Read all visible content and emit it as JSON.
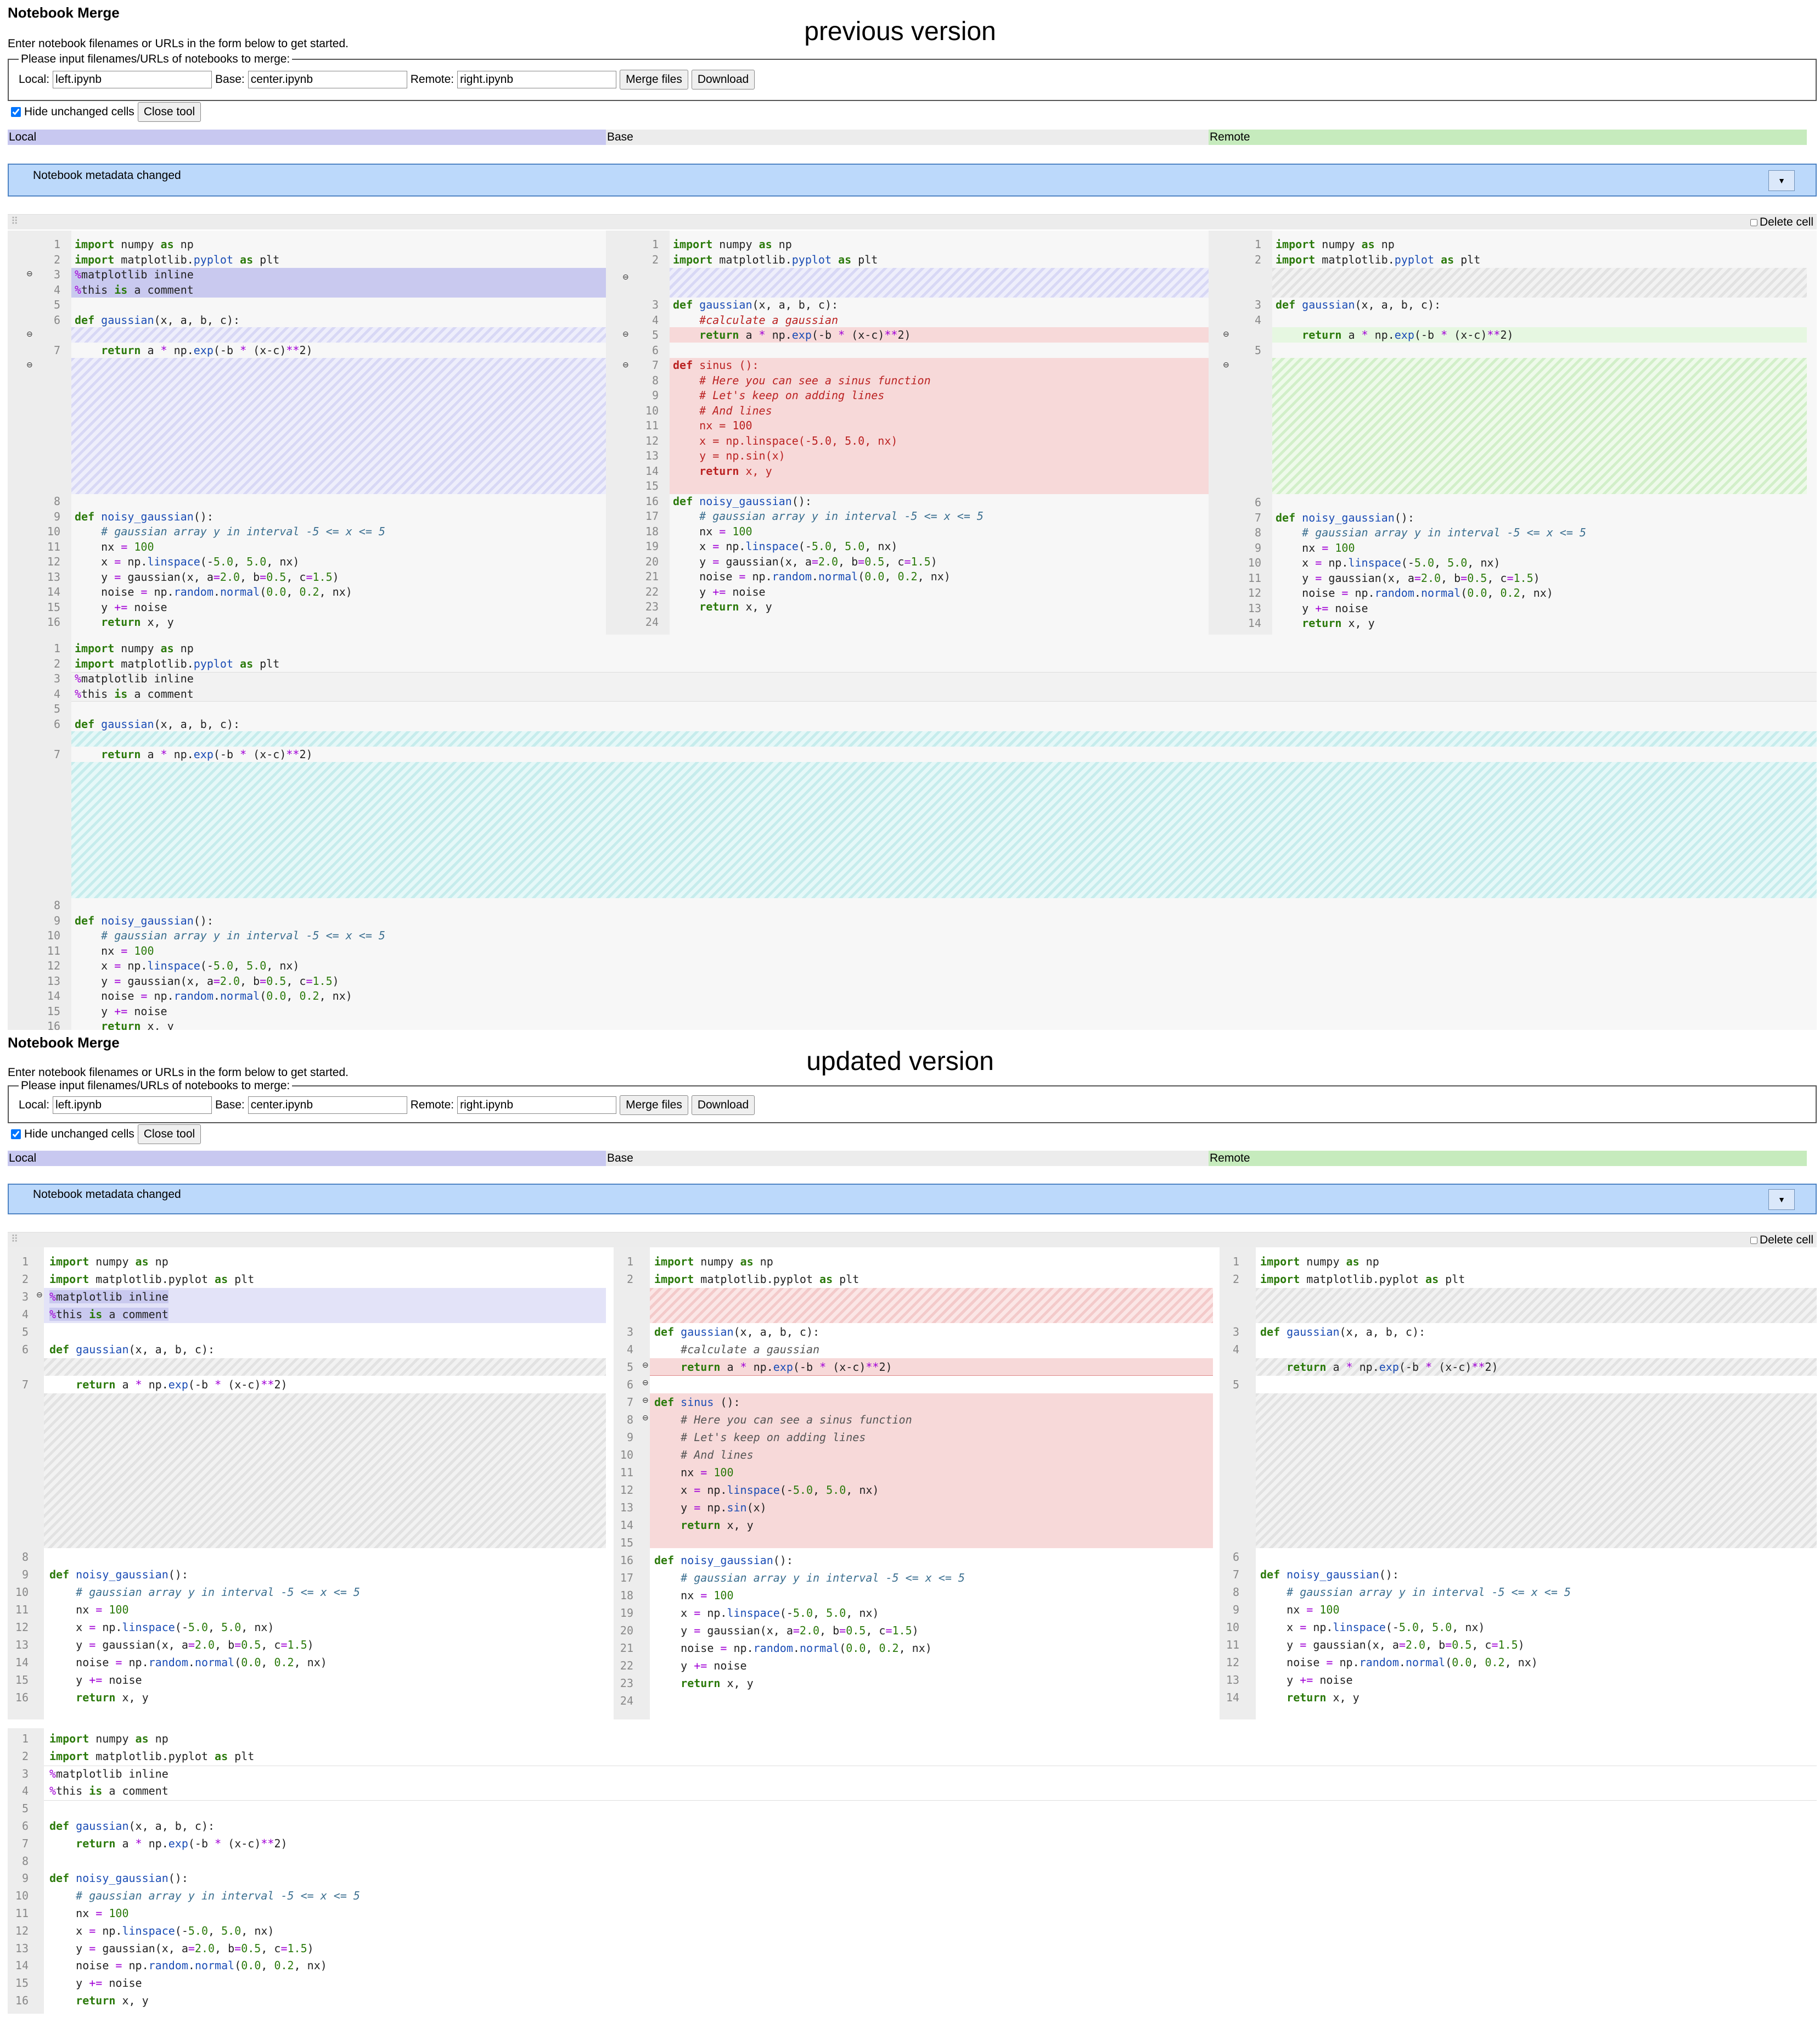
{
  "labels": {
    "previous": "previous version",
    "updated": "updated version"
  },
  "app": {
    "title": "Notebook Merge",
    "instructions": "Enter notebook filenames or URLs in the form below to get started.",
    "legend": "Please input filenames/URLs of notebooks to merge:",
    "local_label": "Local:",
    "base_label": "Base:",
    "remote_label": "Remote:",
    "local_value": "left.ipynb",
    "base_value": "center.ipynb",
    "remote_value": "right.ipynb",
    "merge_button": "Merge files",
    "download_button": "Download",
    "hide_unchanged": "Hide unchanged cells",
    "close_tool": "Close tool",
    "col_local": "Local",
    "col_base": "Base",
    "col_remote": "Remote",
    "metadata_changed": "Notebook metadata changed",
    "delete_cell": "Delete cell"
  },
  "colors": {
    "local": "#c8c8f0",
    "base": "#ececec",
    "remote": "#c6ebbd",
    "metadata": "#bcd9fb"
  },
  "icons": {
    "dropdown": "chevron-down-icon",
    "drag": "drag-handle-icon",
    "merge_marker": "merge-arrow-icon"
  }
}
